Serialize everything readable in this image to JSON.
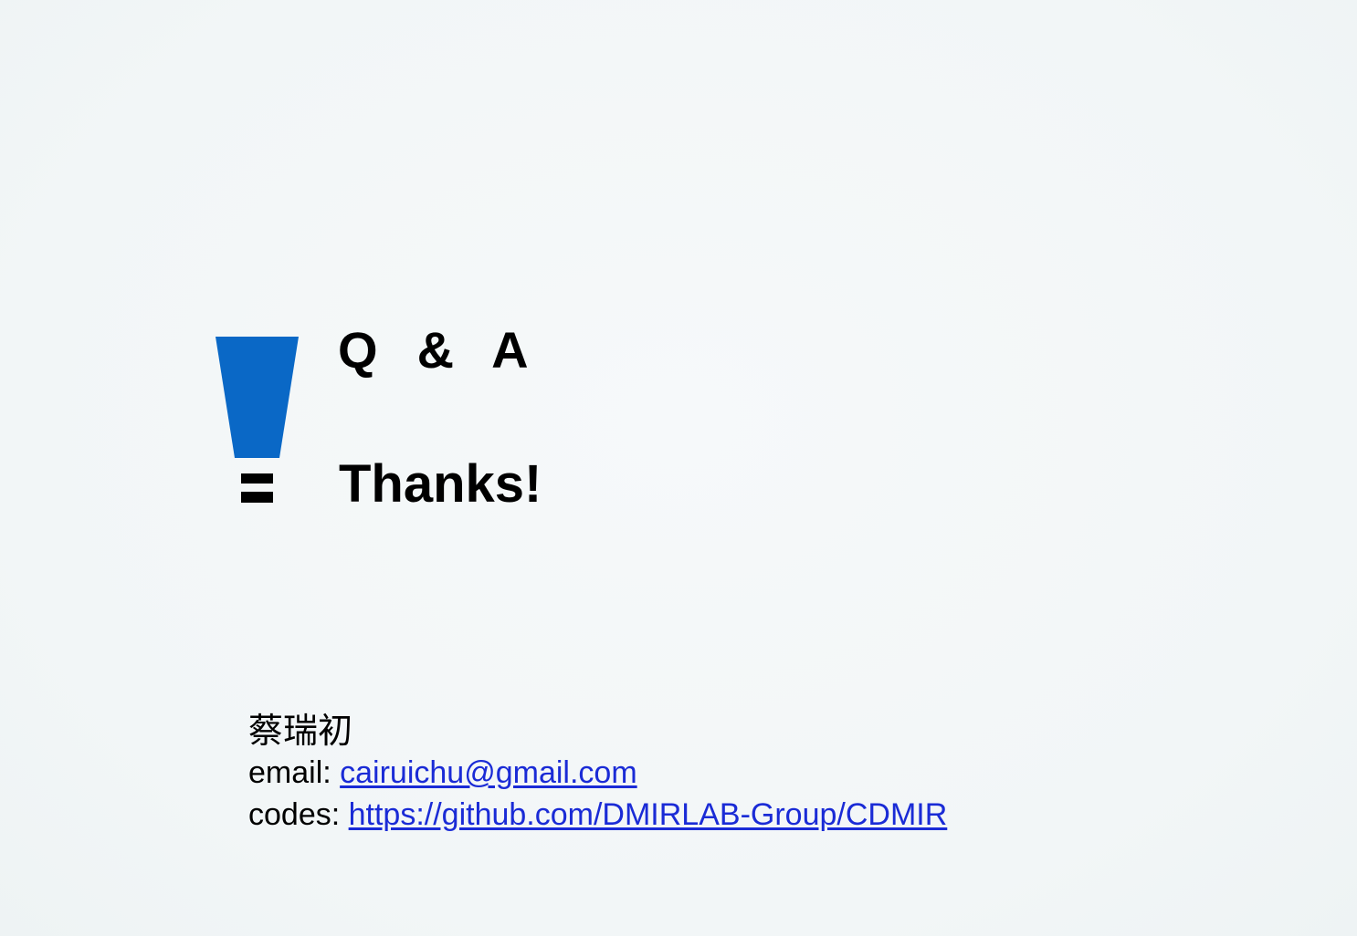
{
  "slide": {
    "title": "Q  &  A",
    "subtitle": "Thanks!",
    "icon": "exclamation-mark-icon",
    "accent_color": "#0a68c6",
    "contact": {
      "name": "蔡瑞初",
      "email_label": "email: ",
      "email_value": "cairuichu@gmail.com",
      "codes_label": "codes: ",
      "codes_value": "https://github.com/DMIRLAB-Group/CDMIR",
      "link_color": "#1a2bd6"
    }
  }
}
